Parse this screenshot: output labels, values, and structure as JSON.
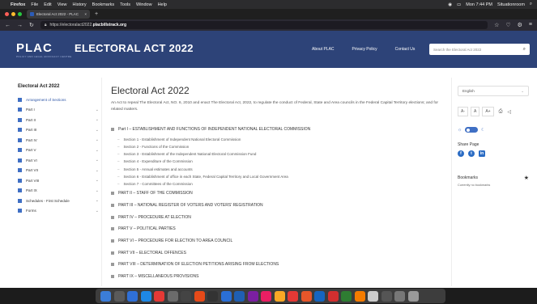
{
  "menubar": {
    "app": "Firefox",
    "menus": [
      "File",
      "Edit",
      "View",
      "History",
      "Bookmarks",
      "Tools",
      "Window",
      "Help"
    ],
    "clock": "Mon 7:44 PM",
    "user": "Situationroom"
  },
  "tab": {
    "title": "Electoral Act 2022 - PLAC"
  },
  "urlbar": {
    "prefix": "https://electoralact2022.",
    "domain": "placbillstrack.org"
  },
  "header": {
    "logo": "PLAC",
    "logo_sub": "POLICY AND LEGAL ADVOCACY CENTRE",
    "title": "ELECTORAL ACT 2022",
    "nav": [
      "About PLAC",
      "Privacy Policy",
      "Contact Us"
    ],
    "search_placeholder": "Search the Electoral Act 2022"
  },
  "sidebar": {
    "title": "Electoral Act 2022",
    "items": [
      {
        "label": "Arrangement of Sections",
        "active": true
      },
      {
        "label": "Part I"
      },
      {
        "label": "Part II"
      },
      {
        "label": "Part III"
      },
      {
        "label": "Part IV"
      },
      {
        "label": "Part V"
      },
      {
        "label": "Part VI"
      },
      {
        "label": "Part VII"
      },
      {
        "label": "Part VIII"
      },
      {
        "label": "Part IX"
      },
      {
        "label": "Schedules - First Schedule"
      },
      {
        "label": "Forms"
      }
    ]
  },
  "content": {
    "title": "Electoral Act 2022",
    "lead": "An Act to repeal The Electoral Act, NO. 6, 2010 and enact The Electoral Act, 2022, to regulate the conduct of Federal, State and Area councils in the Federal Capital Territory elections; and for related matters.",
    "part1": "Part I – ESTABLISHMENT AND FUNCTIONS OF INDEPENDENT NATIONAL ELECTORAL COMMISSION",
    "sections": [
      "Section 1 - Establishment of Independent National Electoral Commission",
      "Section 2 - Functions of the Commission",
      "Section 3 - Establishment of the Independent National Electoral Commission Fund",
      "Section 4 - Expenditure of the Commission",
      "Section 5 - Annual estimates and accounts",
      "Section 6 - Establishment of office in each State, Federal Capital Territory and Local Government Area",
      "Section 7 - Committees of the Commission"
    ],
    "parts": [
      "PART II – STAFF OF THE COMMISSION",
      "PART III – NATIONAL REGISTER OF VOTERS AND VOTERS' REGISTRATION",
      "PART IV – PROCEDURE AT ELECTION",
      "PART V – POLITICAL PARTIES",
      "PART VI – PROCEDURE FOR ELECTION TO AREA COUNCIL",
      "PART VII – ELECTORAL OFFENCES",
      "PART VIII – DETERMINATION OF ELECTION PETITIONS ARISING FROM ELECTIONS",
      "PART IX – MISCELLANEOUS PROVISIONS"
    ]
  },
  "rightpanel": {
    "language": "English",
    "font_buttons": [
      "A-",
      "A",
      "A+"
    ],
    "share_title": "Share Page",
    "bookmarks_title": "Bookmarks",
    "bookmarks_empty": "Currently no bookmarks"
  },
  "dock": {
    "colors": [
      "#3b7dd8",
      "#5a5a5a",
      "#2f6fd6",
      "#1e88e5",
      "#e53935",
      "#6b6b6b",
      "#444",
      "#e64a19",
      "#333",
      "#2a6fd6",
      "#1f5fb3",
      "#7b1fa2",
      "#e91e63",
      "#f9a825",
      "#e53935",
      "#e6562a",
      "#1565c0",
      "#d32f2f",
      "#2e7d32",
      "#f57c00",
      "#ccc",
      "#555",
      "#777",
      "#999"
    ]
  }
}
